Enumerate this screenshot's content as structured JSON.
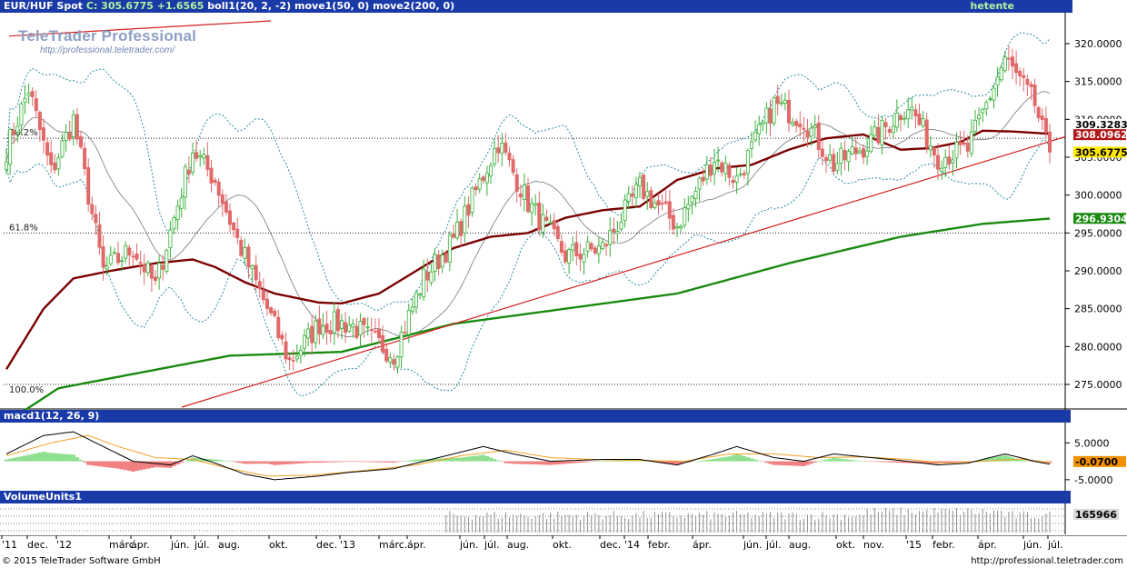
{
  "header": {
    "instrument": "EUR/HUF Spot",
    "close": "C: 305.6775",
    "change": "+1.6565",
    "indicators": "boll1(20, 2, -2)  move1(50, 0)  move2(200, 0)",
    "period": "hetente"
  },
  "logo": {
    "name": "TeleTrader Professional",
    "url": "http://professional.teletrader.com/"
  },
  "footer": {
    "copyright": "© 2015 TeleTrader Software GmbH",
    "url": "http://professional.teletrader.com"
  },
  "colors": {
    "panel_header": "#1a3aa8",
    "up_candle": "#35b035",
    "down_candle": "#e06a6a",
    "move1": "#7a0000",
    "move2": "#1a8a10",
    "trendline": "#d42020",
    "bollinger": "#2a8aa0"
  },
  "chart_data": [
    {
      "type": "candlestick",
      "title": "EUR/HUF Spot",
      "ylim": [
        272.0,
        323.6
      ],
      "y_ticks": [
        "320.0000",
        "315.0000",
        "310.0000",
        "305.0000",
        "300.0000",
        "295.0000",
        "290.0000",
        "285.0000",
        "280.0000",
        "275.0000"
      ],
      "x_ticks": [
        "'11",
        "dec.",
        "'12",
        "márc.",
        "ápr.",
        "jún.",
        "júl.",
        "aug.",
        "okt.",
        "dec.",
        "'13",
        "márc.",
        "ápr.",
        "jún.",
        "júl.",
        "aug.",
        "okt.",
        "dec.",
        "'14",
        "febr.",
        "ápr.",
        "jún.",
        "júl.",
        "aug.",
        "okt.",
        "nov.",
        "'15",
        "febr.",
        "ápr.",
        "jún.",
        "júl."
      ],
      "fib_levels": [
        {
          "label": "38.2%",
          "value": 307.5
        },
        {
          "label": "61.8%",
          "value": 295.0
        },
        {
          "label": "100.0%",
          "value": 275.0
        }
      ],
      "last_values": [
        {
          "label": "309.3283",
          "series": "bollinger_mid"
        },
        {
          "label": "308.0962",
          "series": "move1"
        },
        {
          "label": "305.6775",
          "series": "close"
        },
        {
          "label": "296.9304",
          "series": "move2"
        }
      ],
      "trendline": {
        "from": [
          "2012-08",
          272.0
        ],
        "to": [
          "2015-07",
          308.0
        ]
      },
      "series": [
        {
          "name": "EUR/HUF Spot",
          "color": "#35b035",
          "close_anchors": [
            [
              0,
              306
            ],
            [
              6,
              314
            ],
            [
              12,
              303
            ],
            [
              18,
              310
            ],
            [
              26,
              290
            ],
            [
              34,
              293
            ],
            [
              40,
              288
            ],
            [
              50,
              306
            ],
            [
              56,
              302
            ],
            [
              62,
              294
            ],
            [
              70,
              285
            ],
            [
              76,
              278
            ],
            [
              84,
              283
            ],
            [
              92,
              283
            ],
            [
              104,
              279
            ],
            [
              112,
              289
            ],
            [
              120,
              294
            ],
            [
              132,
              307
            ],
            [
              140,
              299
            ],
            [
              150,
              292
            ],
            [
              160,
              293
            ],
            [
              170,
              301
            ],
            [
              180,
              296
            ],
            [
              190,
              305
            ],
            [
              196,
              302
            ],
            [
              206,
              312
            ],
            [
              214,
              310
            ],
            [
              222,
              304
            ],
            [
              232,
              307
            ],
            [
              242,
              312
            ],
            [
              250,
              305
            ],
            [
              258,
              306
            ],
            [
              268,
              318
            ],
            [
              276,
              312
            ],
            [
              280,
              305
            ]
          ]
        },
        {
          "name": "move1",
          "color": "#7a0000",
          "anchors": [
            [
              0,
              277
            ],
            [
              10,
              285
            ],
            [
              18,
              289
            ],
            [
              28,
              290
            ],
            [
              40,
              291
            ],
            [
              50,
              291.5
            ],
            [
              56,
              290.5
            ],
            [
              64,
              288.5
            ],
            [
              72,
              287
            ],
            [
              84,
              285.8
            ],
            [
              90,
              285.7
            ],
            [
              100,
              287
            ],
            [
              110,
              290
            ],
            [
              120,
              293
            ],
            [
              130,
              294.5
            ],
            [
              140,
              295
            ],
            [
              150,
              297
            ],
            [
              160,
              298
            ],
            [
              170,
              298.5
            ],
            [
              180,
              302
            ],
            [
              190,
              303.5
            ],
            [
              200,
              304
            ],
            [
              210,
              306
            ],
            [
              220,
              307.5
            ],
            [
              230,
              308
            ],
            [
              240,
              306
            ],
            [
              248,
              306.2
            ],
            [
              256,
              307
            ],
            [
              262,
              308.5
            ],
            [
              270,
              308.4
            ],
            [
              280,
              308.1
            ]
          ]
        },
        {
          "name": "move2",
          "color": "#1a8a10",
          "anchors": [
            [
              0,
              270
            ],
            [
              14,
              274.5
            ],
            [
              30,
              276
            ],
            [
              60,
              278.8
            ],
            [
              90,
              279.3
            ],
            [
              120,
              283
            ],
            [
              150,
              285
            ],
            [
              180,
              287
            ],
            [
              210,
              291
            ],
            [
              240,
              294.5
            ],
            [
              262,
              296.2
            ],
            [
              280,
              296.9
            ]
          ]
        },
        {
          "name": "boll1",
          "color": "#2a8aa0"
        }
      ]
    },
    {
      "type": "macd",
      "title": "macd1(12, 26, 9)",
      "ylim": [
        -7.5,
        10.0
      ],
      "y_ticks": [
        "5.0000",
        "-5.0000"
      ],
      "last_value": "-0.0700",
      "macd_anchors": [
        [
          0,
          2
        ],
        [
          10,
          7
        ],
        [
          18,
          8
        ],
        [
          26,
          4
        ],
        [
          34,
          0
        ],
        [
          44,
          -1
        ],
        [
          50,
          1.5
        ],
        [
          56,
          -0.5
        ],
        [
          64,
          -3.5
        ],
        [
          72,
          -5
        ],
        [
          84,
          -4
        ],
        [
          92,
          -3
        ],
        [
          104,
          -2
        ],
        [
          112,
          0
        ],
        [
          120,
          2
        ],
        [
          128,
          4
        ],
        [
          136,
          2
        ],
        [
          146,
          0
        ],
        [
          160,
          0.5
        ],
        [
          170,
          0.5
        ],
        [
          180,
          -1
        ],
        [
          190,
          2
        ],
        [
          196,
          4
        ],
        [
          206,
          1
        ],
        [
          214,
          0
        ],
        [
          222,
          2
        ],
        [
          232,
          1
        ],
        [
          242,
          0
        ],
        [
          250,
          -1
        ],
        [
          258,
          -0.5
        ],
        [
          268,
          2
        ],
        [
          276,
          0
        ],
        [
          280,
          -0.8
        ]
      ],
      "signal_anchors": [
        [
          0,
          1.5
        ],
        [
          12,
          5
        ],
        [
          22,
          7
        ],
        [
          30,
          4
        ],
        [
          40,
          1
        ],
        [
          50,
          0.5
        ],
        [
          60,
          -2
        ],
        [
          70,
          -4
        ],
        [
          82,
          -3.8
        ],
        [
          96,
          -2.5
        ],
        [
          110,
          -1
        ],
        [
          122,
          1.5
        ],
        [
          134,
          3
        ],
        [
          146,
          1
        ],
        [
          160,
          0.4
        ],
        [
          172,
          0.2
        ],
        [
          182,
          0
        ],
        [
          194,
          2
        ],
        [
          206,
          2
        ],
        [
          218,
          1
        ],
        [
          230,
          1.2
        ],
        [
          242,
          0.5
        ],
        [
          252,
          -0.5
        ],
        [
          262,
          0
        ],
        [
          272,
          0.6
        ],
        [
          280,
          -0.3
        ]
      ]
    },
    {
      "type": "bar",
      "title": "VolumeUnits1",
      "last_value": "165966",
      "note": "volume bars begin around Jun 2013"
    }
  ]
}
